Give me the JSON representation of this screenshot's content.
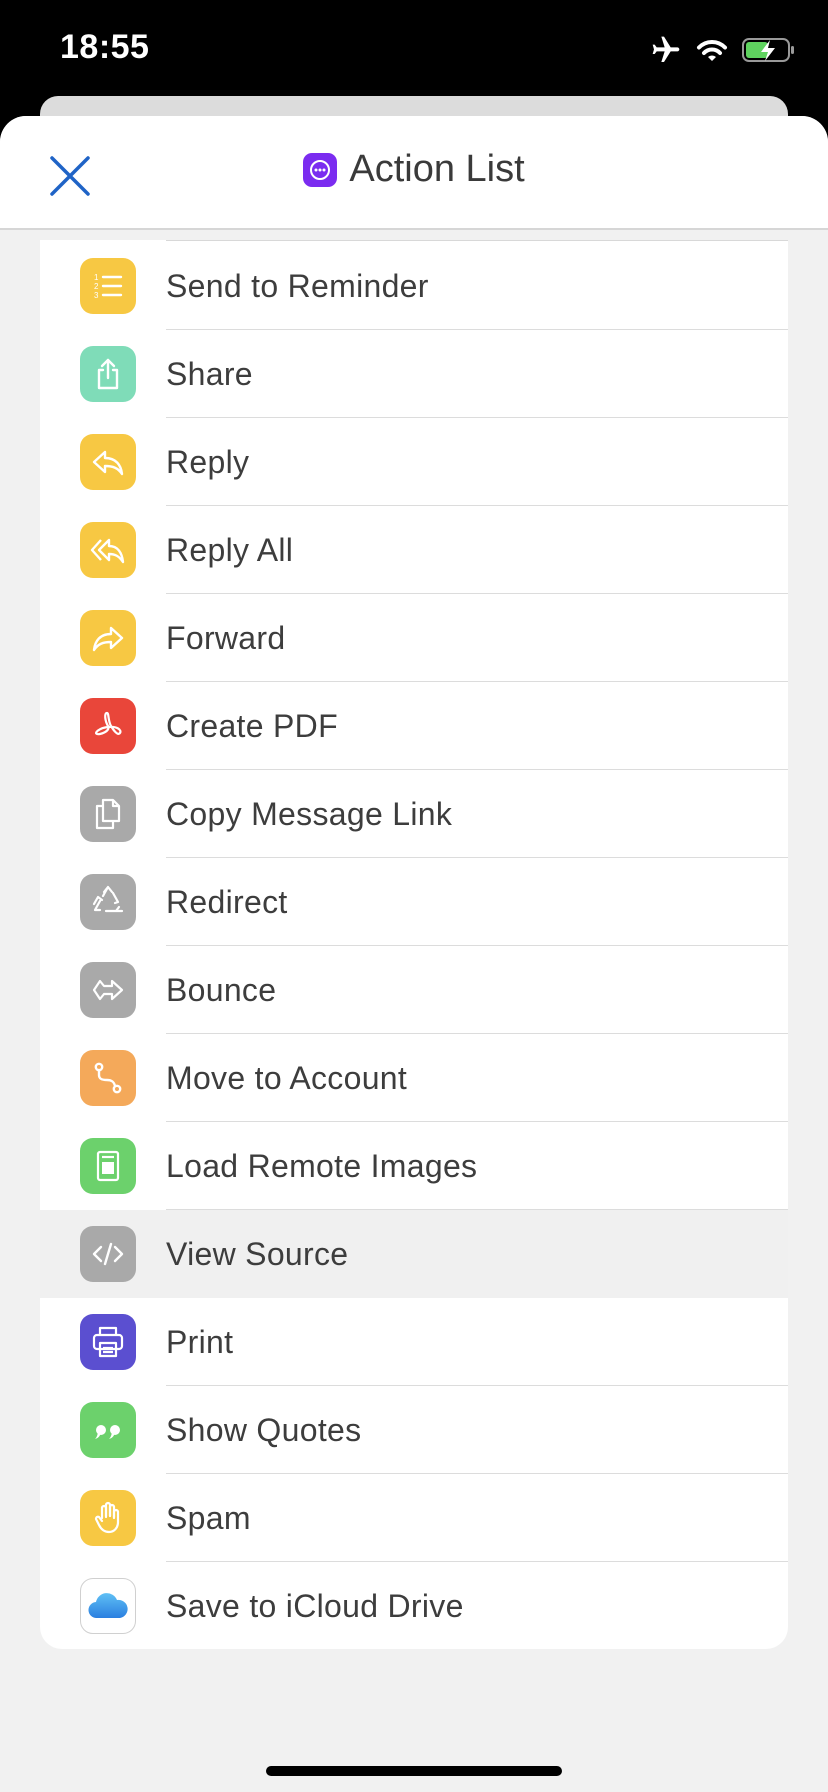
{
  "status_bar": {
    "time": "18:55"
  },
  "nav": {
    "title": "Action List"
  },
  "actions": [
    {
      "label": "Send to Reminder",
      "color": "#f7c843"
    },
    {
      "label": "Share",
      "color": "#7fdcb8"
    },
    {
      "label": "Reply",
      "color": "#f7c843"
    },
    {
      "label": "Reply All",
      "color": "#f7c843"
    },
    {
      "label": "Forward",
      "color": "#f7c843"
    },
    {
      "label": "Create PDF",
      "color": "#e9463a"
    },
    {
      "label": "Copy Message Link",
      "color": "#a9a9a9"
    },
    {
      "label": "Redirect",
      "color": "#a9a9a9"
    },
    {
      "label": "Bounce",
      "color": "#a9a9a9"
    },
    {
      "label": "Move to Account",
      "color": "#f4a95a"
    },
    {
      "label": "Load Remote Images",
      "color": "#6cd16c"
    },
    {
      "label": "View Source",
      "color": "#a9a9a9"
    },
    {
      "label": "Print",
      "color": "#5b4fd0"
    },
    {
      "label": "Show Quotes",
      "color": "#6cd16c"
    },
    {
      "label": "Spam",
      "color": "#f7c843"
    },
    {
      "label": "Save to iCloud Drive",
      "color": "#ffffff"
    }
  ]
}
